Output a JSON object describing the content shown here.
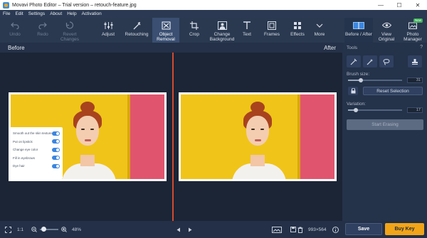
{
  "window": {
    "title": "Movavi Photo Editor – Trial version – retouch-feature.jpg",
    "controls": [
      "—",
      "☐",
      "✕"
    ]
  },
  "menu": [
    "File",
    "Edit",
    "Settings",
    "About",
    "Help",
    "Activation"
  ],
  "toolbar": {
    "undo": "Undo",
    "redo": "Redo",
    "revert": "Revert Changes",
    "adjust": "Adjust",
    "retouching": "Retouching",
    "object_removal": "Object Removal",
    "crop": "Crop",
    "change_background": "Change Background",
    "text": "Text",
    "frames": "Frames",
    "effects": "Effects",
    "more": "More",
    "before_after": "Before / After",
    "view_original": "View Original",
    "photo_manager": "Photo Manager",
    "new_badge": "New"
  },
  "canvas": {
    "before_label": "Before",
    "after_label": "After"
  },
  "retouch_popover": {
    "items": [
      {
        "label": "Smooth out the skin texture"
      },
      {
        "label": "Put on lipstick"
      },
      {
        "label": "Change eye color"
      },
      {
        "label": "Fill in eyebrows"
      },
      {
        "label": "Dye hair"
      }
    ]
  },
  "panel": {
    "title": "Tools",
    "help": "?",
    "brush_size_label": "Brush size:",
    "brush_size_value": "31",
    "brush_size_fraction": 0.24,
    "reset_label": "Reset Selection",
    "variation_label": "Variation:",
    "variation_value": "17",
    "variation_fraction": 0.14,
    "start_erasing_label": "Start Erasing"
  },
  "bottom": {
    "scale_label": "1:1",
    "zoom_value": "48%",
    "zoom_fraction": 0.1,
    "image_size": "993×564",
    "save_label": "Save",
    "buy_key_label": "Buy Key"
  },
  "colors": {
    "accent_orange": "#f2a418",
    "divider_red": "#d24a2f",
    "toggle_blue": "#3a86e0"
  }
}
